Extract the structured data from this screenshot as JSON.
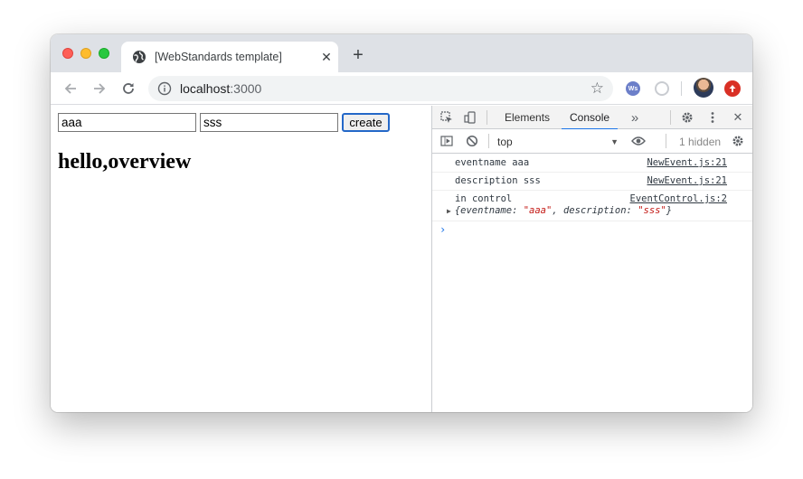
{
  "browser": {
    "tab_title": "[WebStandards template]",
    "tab_close": "✕",
    "new_tab": "+",
    "url_host": "localhost",
    "url_port": ":3000",
    "star": "☆",
    "ext_label": "Ws"
  },
  "page": {
    "input1_value": "aaa",
    "input2_value": "sss",
    "create_label": "create",
    "heading": "hello,overview"
  },
  "devtools": {
    "tabs": [
      "Elements",
      "Console"
    ],
    "active_tab": "Console",
    "more_tabs": "»",
    "close": "✕",
    "context": "top",
    "context_caret": "▼",
    "hidden_count": "1 hidden",
    "messages": [
      {
        "text": "eventname aaa",
        "source": "NewEvent.js:21"
      },
      {
        "text": "description sss",
        "source": "NewEvent.js:21"
      },
      {
        "text": "in control",
        "source": "EventControl.js:2"
      }
    ],
    "object": {
      "triangle": "▶",
      "open": "{",
      "key1": "eventname",
      "val1": "\"aaa\"",
      "key2": "description",
      "val2": "\"sss\"",
      "close": "}"
    },
    "prompt": "›"
  },
  "colors": {
    "accent": "#1a73e8",
    "string": "#c41a16",
    "titlebar": "#dee1e6"
  }
}
